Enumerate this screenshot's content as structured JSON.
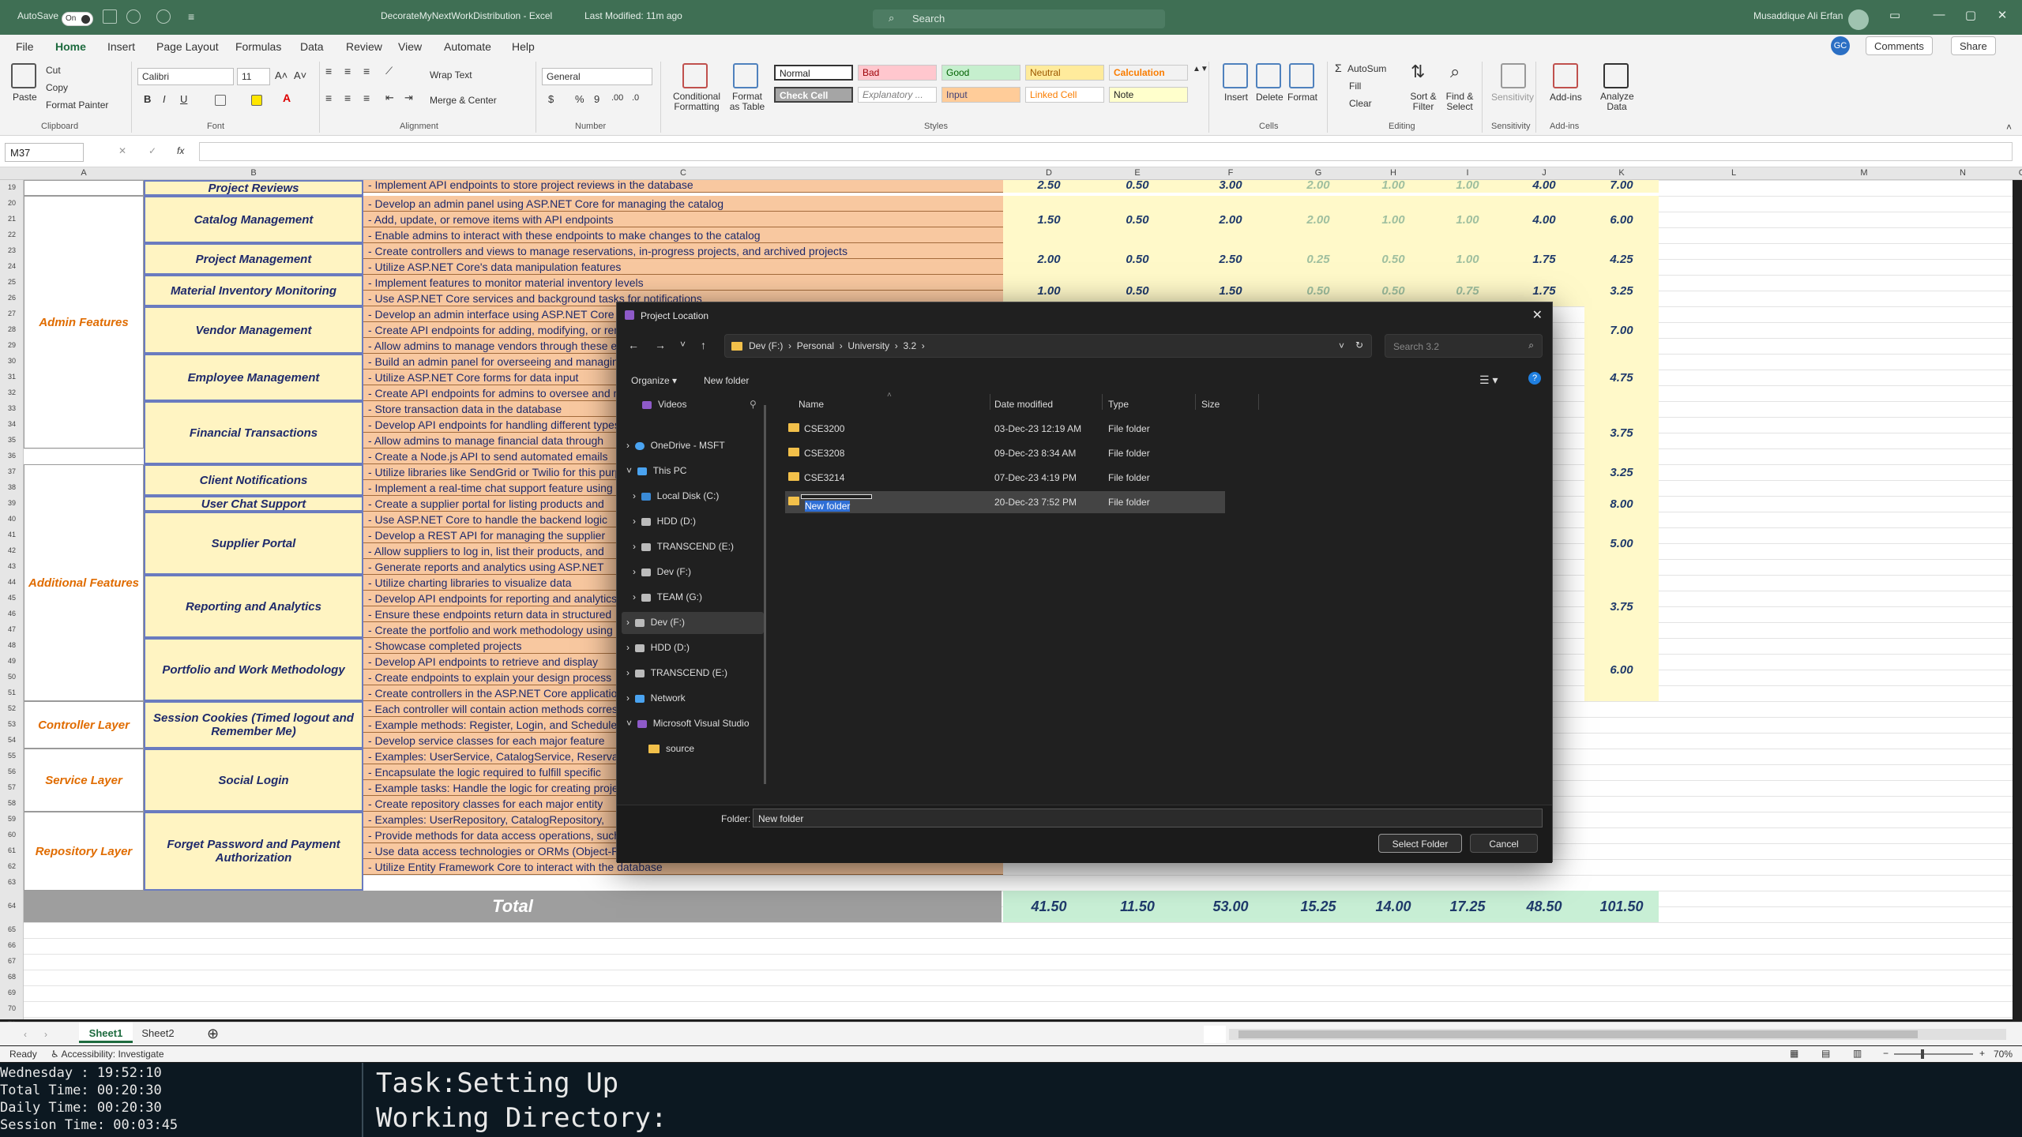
{
  "titlebar": {
    "autosave": "AutoSave",
    "toggle": "On",
    "doc_title": "DecorateMyNextWorkDistribution  -  Excel",
    "modified": "Last Modified: 11m ago",
    "search_placeholder": "Search",
    "user": "Musaddique Ali Erfan"
  },
  "menu": {
    "tabs": [
      "File",
      "Home",
      "Insert",
      "Page Layout",
      "Formulas",
      "Data",
      "Review",
      "View",
      "Automate",
      "Help"
    ],
    "comments": "Comments",
    "share": "Share",
    "gc": "GC"
  },
  "ribbon": {
    "paste": "Paste",
    "cut": "Cut",
    "copy": "Copy",
    "format_painter": "Format Painter",
    "clipboard": "Clipboard",
    "font_name": "Calibri",
    "font_size": "11",
    "font": "Font",
    "wrap_text": "Wrap Text",
    "merge_center": "Merge & Center",
    "alignment": "Alignment",
    "number_format": "General",
    "number": "Number",
    "conditional": "Conditional Formatting",
    "format_as_table": "Format as Table",
    "styles_list": [
      "Normal",
      "Bad",
      "Good",
      "Neutral",
      "Calculation",
      "Check Cell",
      "Explanatory ...",
      "Input",
      "Linked Cell",
      "Note"
    ],
    "styles": "Styles",
    "insert": "Insert",
    "delete": "Delete",
    "format": "Format",
    "cells": "Cells",
    "autosum": "AutoSum",
    "fill": "Fill",
    "clear": "Clear",
    "sort_filter": "Sort & Filter",
    "find_select": "Find & Select",
    "editing": "Editing",
    "sensitivity": "Sensitivity",
    "add_ins": "Add-ins",
    "analyze": "Analyze Data"
  },
  "formula": {
    "namebox": "M37",
    "fx": "fx"
  },
  "columns": [
    "A",
    "B",
    "C",
    "D",
    "E",
    "F",
    "G",
    "H",
    "I",
    "J",
    "K",
    "L",
    "M",
    "N",
    "O"
  ],
  "rows": [
    "19",
    "20",
    "21",
    "22",
    "23",
    "24",
    "25",
    "26",
    "27",
    "28",
    "29",
    "30",
    "31",
    "32",
    "33",
    "34",
    "35",
    "36",
    "37",
    "38",
    "39",
    "40",
    "41",
    "42",
    "43",
    "44",
    "45",
    "46",
    "47",
    "48",
    "49",
    "50",
    "51",
    "52",
    "53",
    "54",
    "55",
    "56",
    "57",
    "58",
    "59",
    "60",
    "61",
    "62",
    "63",
    "64",
    "65",
    "66",
    "67",
    "68",
    "69",
    "70",
    "71"
  ],
  "sheet": {
    "categories": [
      "Admin Features",
      "Additional Features",
      "Controller Layer",
      "Service Layer",
      "Repository Layer"
    ],
    "features": [
      "Project Reviews",
      "Catalog Management",
      "Project Management",
      "Material Inventory Monitoring",
      "Vendor Management",
      "Employee Management",
      "Financial Transactions",
      "Client Notifications",
      "User Chat Support",
      "Supplier Portal",
      "Reporting and Analytics",
      "Portfolio and Work Methodology",
      "Session Cookies (Timed logout and Remember Me)",
      "Social Login",
      "Forget Password and Payment Authorization"
    ],
    "tasks": [
      "- Implement API endpoints to store project reviews in the database",
      "- Develop an admin panel using ASP.NET Core for managing the catalog",
      "- Add, update, or remove items with API endpoints",
      "- Enable admins to interact with these endpoints to make changes to the catalog",
      "- Create controllers and views to manage reservations, in-progress projects, and archived projects",
      "- Utilize ASP.NET Core's data manipulation features",
      "- Implement features to monitor material inventory levels",
      "- Use ASP.NET Core services and background tasks for notifications",
      "- Develop an admin interface using ASP.NET Core",
      "- Create API endpoints for adding, modifying, or removing vendors",
      "- Allow admins to manage vendors through these endpoints",
      "- Build an admin panel for overseeing and managing employees",
      "- Utilize ASP.NET Core forms for data input",
      "- Create API endpoints for admins to oversee and manage",
      "- Store transaction data in the database",
      "- Develop API endpoints for handling different types",
      "- Allow admins to manage financial data through",
      "- Create a Node.js API to send automated emails",
      "- Utilize libraries like SendGrid or Twilio for this purpose",
      "- Implement a real-time chat support feature using",
      "- Create a supplier portal for listing products and",
      "- Use ASP.NET Core to handle the backend logic",
      "- Develop a REST API for managing the supplier",
      "- Allow suppliers to log in, list their products, and",
      "- Generate reports and analytics using ASP.NET",
      "- Utilize charting libraries to visualize data",
      "- Develop API endpoints for reporting and analytics",
      "- Ensure these endpoints return data in structured",
      "- Create the portfolio and work methodology using",
      "- Showcase completed projects",
      "- Develop API endpoints to retrieve and display",
      "- Create endpoints to explain your design process",
      "- Create controllers in the ASP.NET Core application",
      "- Each controller will contain action methods corresponding",
      "- Example methods: Register, Login, and Schedule",
      "- Develop service classes for each major feature",
      "- Examples: UserService, CatalogService, Reservation",
      "- Encapsulate the logic required to fulfill specific",
      "- Example tasks: Handle the logic for creating projects",
      "- Create repository classes for each major entity",
      "- Examples: UserRepository, CatalogRepository,",
      "- Provide methods for data access operations, such",
      "- Use data access technologies or ORMs (Object-Relational Mapping) for data operations",
      "- Utilize Entity Framework Core to interact with the database"
    ],
    "values_top": [
      [
        "2.50",
        "0.50",
        "3.00",
        "2.00",
        "1.00",
        "1.00",
        "4.00",
        "7.00"
      ],
      [
        "1.50",
        "0.50",
        "2.00",
        "2.00",
        "1.00",
        "1.00",
        "4.00",
        "6.00"
      ],
      [
        "2.00",
        "0.50",
        "2.50",
        "0.25",
        "0.50",
        "1.00",
        "1.75",
        "4.25"
      ],
      [
        "1.00",
        "0.50",
        "1.50",
        "0.50",
        "0.50",
        "0.75",
        "1.75",
        "3.25"
      ]
    ],
    "k_values": [
      "7.00",
      "4.75",
      "3.75",
      "3.25",
      "8.00",
      "5.00",
      "3.75",
      "6.00"
    ],
    "total_label": "Total",
    "totals": [
      "41.50",
      "11.50",
      "53.00",
      "15.25",
      "14.00",
      "17.25",
      "48.50",
      "101.50"
    ]
  },
  "dialog": {
    "title": "Project Location",
    "path": [
      "Dev (F:)",
      "Personal",
      "University",
      "3.2"
    ],
    "search_placeholder": "Search 3.2",
    "organize": "Organize",
    "new_folder_btn": "New folder",
    "cols": [
      "Name",
      "Date modified",
      "Type",
      "Size"
    ],
    "nav": [
      "Videos",
      "OneDrive - MSFT",
      "This PC",
      "Local Disk (C:)",
      "HDD (D:)",
      "TRANSCEND (E:)",
      "Dev (F:)",
      "TEAM (G:)",
      "Dev (F:)",
      "HDD (D:)",
      "TRANSCEND (E:)",
      "Network",
      "Microsoft Visual Studio",
      "source"
    ],
    "files": [
      {
        "name": "CSE3200",
        "date": "03-Dec-23 12:19 AM",
        "type": "File folder"
      },
      {
        "name": "CSE3208",
        "date": "09-Dec-23 8:34 AM",
        "type": "File folder"
      },
      {
        "name": "CSE3214",
        "date": "07-Dec-23 4:19 PM",
        "type": "File folder"
      },
      {
        "name": "New folder",
        "date": "20-Dec-23 7:52 PM",
        "type": "File folder"
      }
    ],
    "folder_label": "Folder:",
    "folder_value": "New folder",
    "select_btn": "Select Folder",
    "cancel_btn": "Cancel"
  },
  "tabs": {
    "sheet1": "Sheet1",
    "sheet2": "Sheet2"
  },
  "status": {
    "ready": "Ready",
    "accessibility": "Accessibility: Investigate",
    "zoom": "70%"
  },
  "terminal": {
    "day": "Wednesday  :  19:52:10",
    "total": "Total Time: 00:20:30",
    "daily": "Daily Time: 00:20:30",
    "session": "Session Time: 00:03:45",
    "task": "Task:Setting Up",
    "dir": "Working Directory:"
  }
}
